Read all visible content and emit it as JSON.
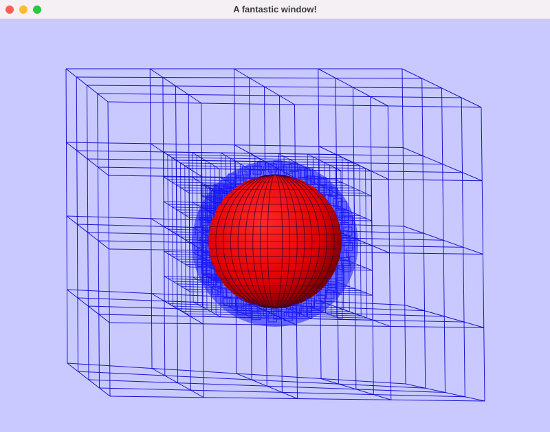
{
  "window": {
    "title": "A fantastic window!",
    "controls": {
      "close_color": "#ff5f57",
      "minimize_color": "#febc2e",
      "maximize_color": "#28c840"
    }
  },
  "scene": {
    "background_color": "#c9c9ff",
    "grid_line_color": "#0000cc",
    "sphere_color": "#e00000",
    "sphere_mesh_color": "#1a1aff",
    "octree_levels": 3
  }
}
